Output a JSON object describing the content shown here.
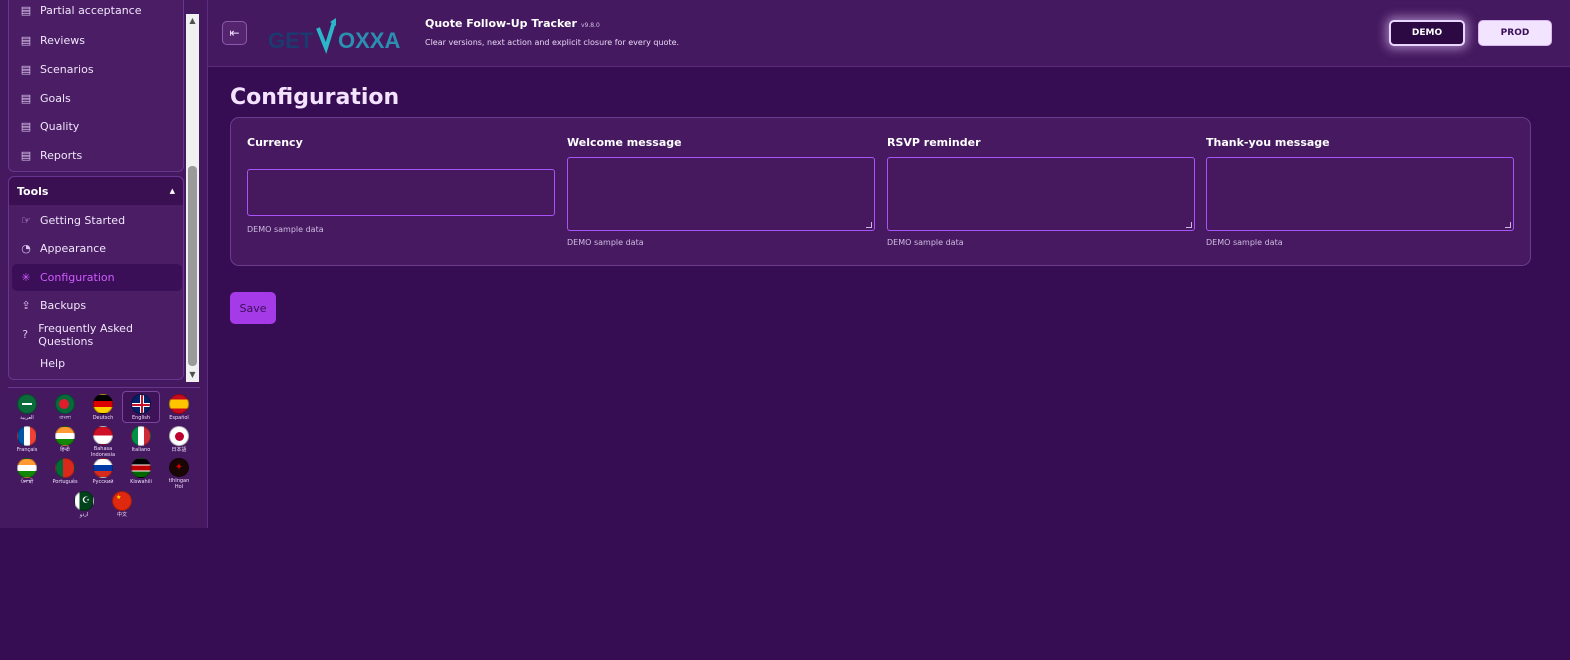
{
  "app": {
    "title": "Quote Follow-Up Tracker",
    "version": "v9.8.0",
    "subtitle": "Clear versions, next action and explicit closure for every quote.",
    "logo_text_left": "GET",
    "logo_text_right": "OXXA"
  },
  "env": {
    "demo_label": "DEMO",
    "prod_label": "PROD",
    "active": "DEMO"
  },
  "sidebar": {
    "partial_item": "Partial acceptance",
    "items": [
      {
        "label": "Reviews",
        "icon": "document-icon"
      },
      {
        "label": "Scenarios",
        "icon": "document-icon"
      },
      {
        "label": "Goals",
        "icon": "document-icon"
      },
      {
        "label": "Quality",
        "icon": "document-icon"
      },
      {
        "label": "Reports",
        "icon": "document-icon"
      }
    ],
    "tools_title": "Tools",
    "tools_items": [
      {
        "label": "Getting Started",
        "icon": "pointer-icon"
      },
      {
        "label": "Appearance",
        "icon": "palette-icon"
      },
      {
        "label": "Configuration",
        "icon": "sparkle-icon",
        "active": true
      },
      {
        "label": "Backups",
        "icon": "upload-icon"
      },
      {
        "label": "Frequently Asked Questions",
        "icon": "help-circle-icon"
      },
      {
        "label": "Help",
        "icon": ""
      }
    ]
  },
  "languages": [
    {
      "name": "العربية",
      "code": "ar"
    },
    {
      "name": "বাংলা",
      "code": "bn"
    },
    {
      "name": "Deutsch",
      "code": "de"
    },
    {
      "name": "English",
      "code": "en",
      "selected": true
    },
    {
      "name": "Español",
      "code": "es"
    },
    {
      "name": "Français",
      "code": "fr"
    },
    {
      "name": "हिन्दी",
      "code": "hi"
    },
    {
      "name": "Bahasa Indonesia",
      "code": "id"
    },
    {
      "name": "Italiano",
      "code": "it"
    },
    {
      "name": "日本語",
      "code": "ja"
    },
    {
      "name": "ਪੰਜਾਬੀ",
      "code": "pa"
    },
    {
      "name": "Português",
      "code": "pt"
    },
    {
      "name": "Русский",
      "code": "ru"
    },
    {
      "name": "Kiswahili",
      "code": "sw"
    },
    {
      "name": "tlhIngan Hol",
      "code": "tlh"
    },
    {
      "name": "اردو",
      "code": "ur"
    },
    {
      "name": "中文",
      "code": "zh"
    }
  ],
  "page": {
    "title": "Configuration",
    "fields": [
      {
        "label": "Currency",
        "value": "",
        "hint": "DEMO sample data"
      },
      {
        "label": "Welcome message",
        "value": "",
        "hint": "DEMO sample data"
      },
      {
        "label": "RSVP reminder",
        "value": "",
        "hint": "DEMO sample data"
      },
      {
        "label": "Thank-you message",
        "value": "",
        "hint": "DEMO sample data"
      }
    ],
    "save_label": "Save"
  },
  "colors": {
    "background": "#360c52",
    "panel": "#45195f",
    "accent": "#a855f7",
    "active_nav_text": "#d05bff",
    "save_button": "#a43ae8"
  }
}
